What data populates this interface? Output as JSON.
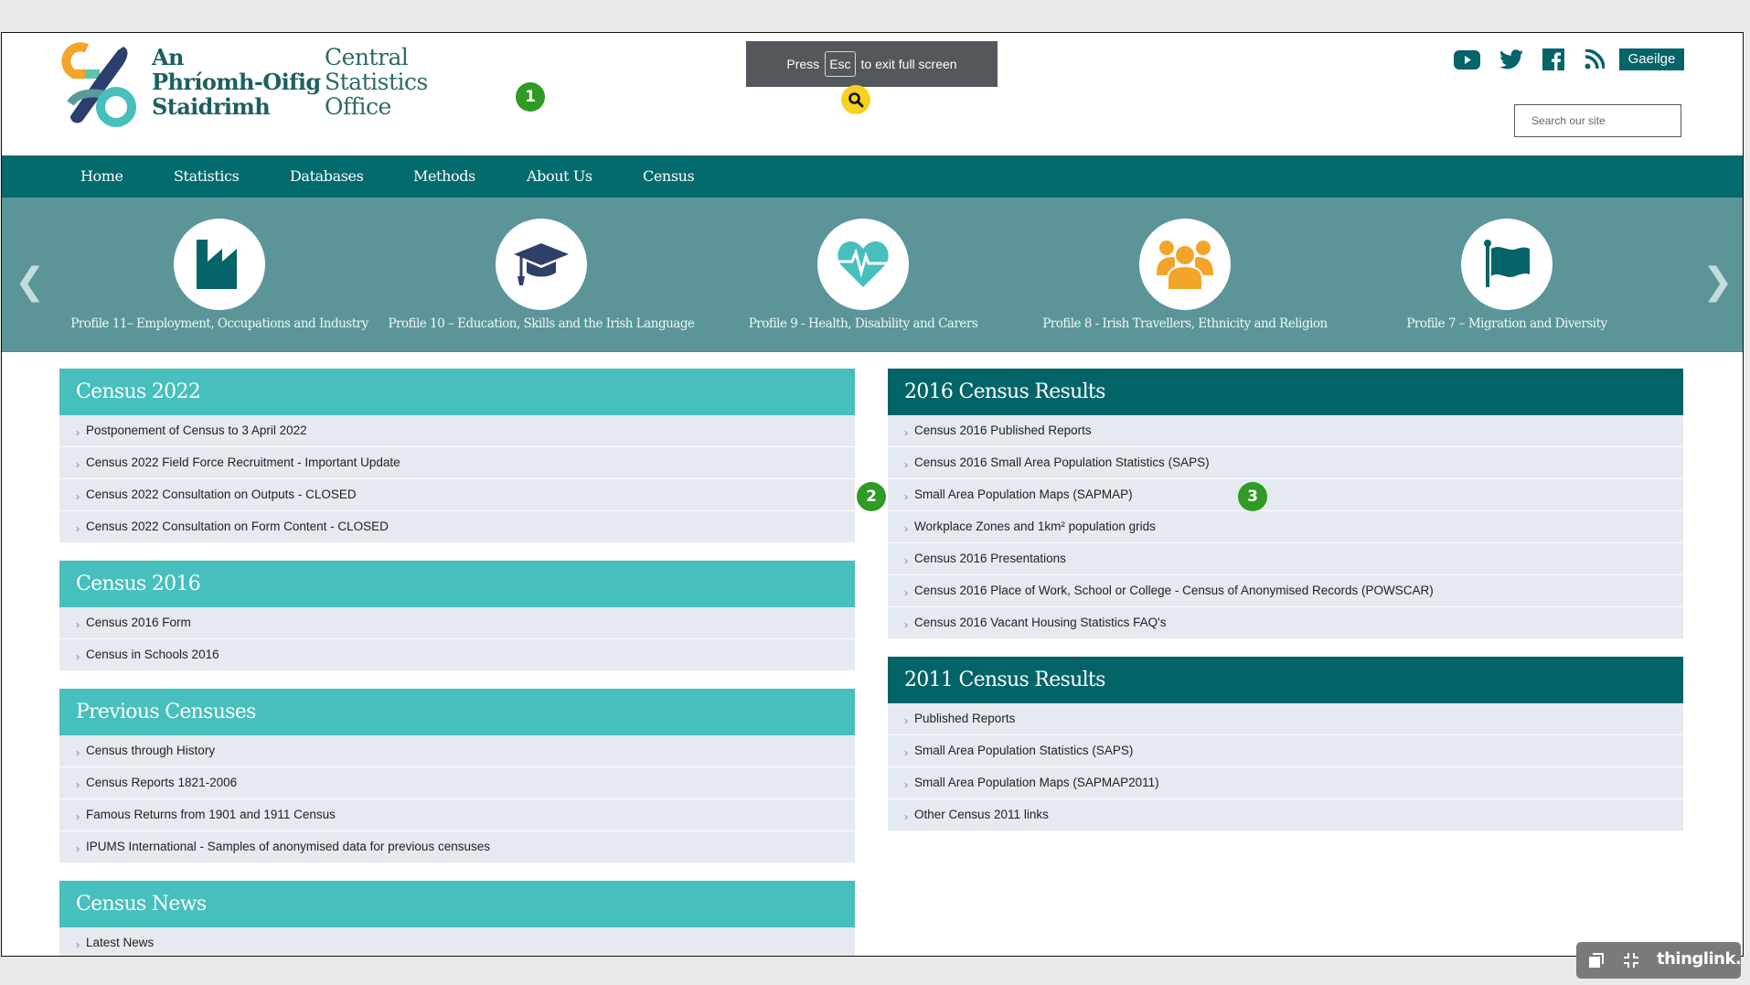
{
  "header": {
    "logo_name": "cso-logo",
    "brand_irish": [
      "An",
      "Phríomh-Oifig",
      "Staidrimh"
    ],
    "brand_english": [
      "Central",
      "Statistics",
      "Office"
    ],
    "social": [
      "youtube-icon",
      "twitter-icon",
      "facebook-icon",
      "rss-icon"
    ],
    "language_button": "Gaeilge",
    "search_placeholder": "Search our site",
    "search_value": ""
  },
  "nav": {
    "items": [
      "Home",
      "Statistics",
      "Databases",
      "Methods",
      "About Us",
      "Census"
    ]
  },
  "carousel": {
    "prev_icon": "chevron-left-icon",
    "next_icon": "chevron-right-icon",
    "slides": [
      {
        "label": "Profile 11– Employment, Occupations and Industry",
        "icon": "factory-icon"
      },
      {
        "label": "Profile 10 – Education, Skills and the Irish Language",
        "icon": "graduation-cap-icon"
      },
      {
        "label": "Profile 9 - Health, Disability and Carers",
        "icon": "heart-pulse-icon"
      },
      {
        "label": "Profile 8 - Irish Travellers, Ethnicity and Religion",
        "icon": "people-group-icon"
      },
      {
        "label": "Profile 7 – Migration and Diversity",
        "icon": "flag-icon"
      }
    ]
  },
  "left_panels": [
    {
      "title": "Census 2022",
      "items": [
        "Postponement of Census to 3 April 2022",
        "Census 2022 Field Force Recruitment - Important Update",
        "Census 2022 Consultation on Outputs - CLOSED",
        "Census 2022 Consultation on Form Content - CLOSED"
      ]
    },
    {
      "title": "Census 2016",
      "items": [
        "Census 2016 Form",
        "Census in Schools 2016"
      ]
    },
    {
      "title": "Previous Censuses",
      "items": [
        "Census through History",
        "Census Reports 1821-2006",
        "Famous Returns from 1901 and 1911 Census",
        "IPUMS International - Samples of anonymised data for previous censuses"
      ]
    },
    {
      "title": "Census News",
      "items": [
        "Latest News"
      ]
    }
  ],
  "right_panels": [
    {
      "title": "2016 Census Results",
      "items": [
        "Census 2016 Published Reports",
        "Census 2016 Small Area Population Statistics (SAPS)",
        "Small Area Population Maps (SAPMAP)",
        "Workplace Zones and 1km² population grids",
        "Census 2016 Presentations",
        "Census 2016 Place of Work, School or College - Census of Anonymised Records (POWSCAR)",
        "Census 2016 Vacant Housing Statistics FAQ's"
      ]
    },
    {
      "title": "2011 Census Results",
      "items": [
        "Published Reports",
        "Small Area Population Statistics (SAPS)",
        "Small Area Population Maps (SAPMAP2011)",
        "Other Census 2011 links"
      ]
    }
  ],
  "overlay": {
    "toast_before": "Press",
    "toast_key": "Esc",
    "toast_after": "to exit full screen",
    "markers": [
      "1",
      "2",
      "3"
    ],
    "thinglink_brand": "thinglink."
  },
  "colors": {
    "nav_bg": "#036a6d",
    "carousel_bg": "#5b9597",
    "panel_head_light": "#46bfbd",
    "panel_head_dark": "#036468",
    "row_bg": "#e5e9f0",
    "marker_green": "#2f9a24",
    "accent_orange": "#f5a42a"
  }
}
